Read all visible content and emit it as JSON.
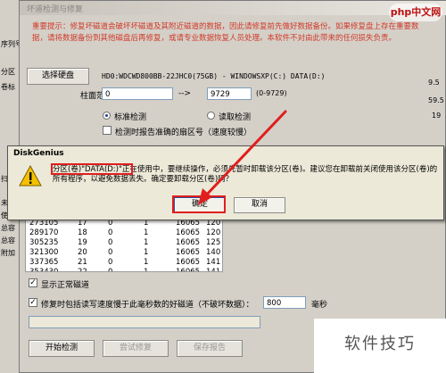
{
  "left_strip": [
    "序列号",
    "分区",
    "卷标",
    "扫",
    "未",
    "使",
    "总容",
    "总容",
    "附加"
  ],
  "main_dialog": {
    "title": "坏道检测与修复",
    "warning": "重要提示：修复坏磁道会破坏坏磁道及其附近磁道的数据，因此请修复前先做好数据备份。如果修复盘上存在重要数据，请将数据备份到其他磁盘后再修复，或请专业数据恢复人员处理。本软件不对由此带来的任何损失负责。",
    "select_disk_button": "选择硬盘",
    "disk_info": "HD0:WDCWD800BB-22JHC0(75GB) - WINDOWSXP(C:) DATA(D:)",
    "cylinder_range_label": "柱面范围：",
    "cylinder_from": "0",
    "range_arrow": "-->",
    "cylinder_to": "9729",
    "cylinder_hint": "(0-9729)",
    "radio_standard": "标准检测",
    "radio_read": "读取检测",
    "checkbox_report_label": "检测时报告准确的扇区号（速度较慢）",
    "show_normal_label": "显示正常磁道",
    "repair_slow_label": "修复时包括读写速度慢于此毫秒数的好磁道（不破坏数据）：",
    "ms_value": "800",
    "ms_unit": "毫秒",
    "start_button": "开始检测",
    "repair_button": "尝试修复",
    "save_report_button": "保存报告"
  },
  "results": {
    "rows": [
      [
        "273105",
        "17",
        "0",
        "1",
        "16065",
        "120"
      ],
      [
        "289170",
        "18",
        "0",
        "1",
        "16065",
        "120"
      ],
      [
        "305235",
        "19",
        "0",
        "1",
        "16065",
        "125"
      ],
      [
        "321300",
        "20",
        "0",
        "1",
        "16065",
        "140"
      ],
      [
        "337365",
        "21",
        "0",
        "1",
        "16065",
        "141"
      ],
      [
        "353430",
        "22",
        "0",
        "1",
        "16065",
        "141"
      ]
    ]
  },
  "right_col": [
    "9.5",
    "59.5",
    "19"
  ],
  "overlay": {
    "title": "DiskGenius",
    "message": "分区(卷)\"DATA(D:)\"正在使用中，要继续操作，必须先暂时卸载该分区(卷)。建议您在卸载前关闭使用该分区(卷)的所有程序，以避免数据丢失。确定要卸载分区(卷)吗？",
    "ok_label": "确定",
    "cancel_label": "取消"
  },
  "watermarks": {
    "top": "php中文网",
    "bottom": "软件技巧"
  },
  "colors": {
    "warning_text": "#d23a2a",
    "highlight_red": "#e01e1e",
    "dialog_bg": "#d4d0c8",
    "overlay_bg": "#ece9d8"
  }
}
